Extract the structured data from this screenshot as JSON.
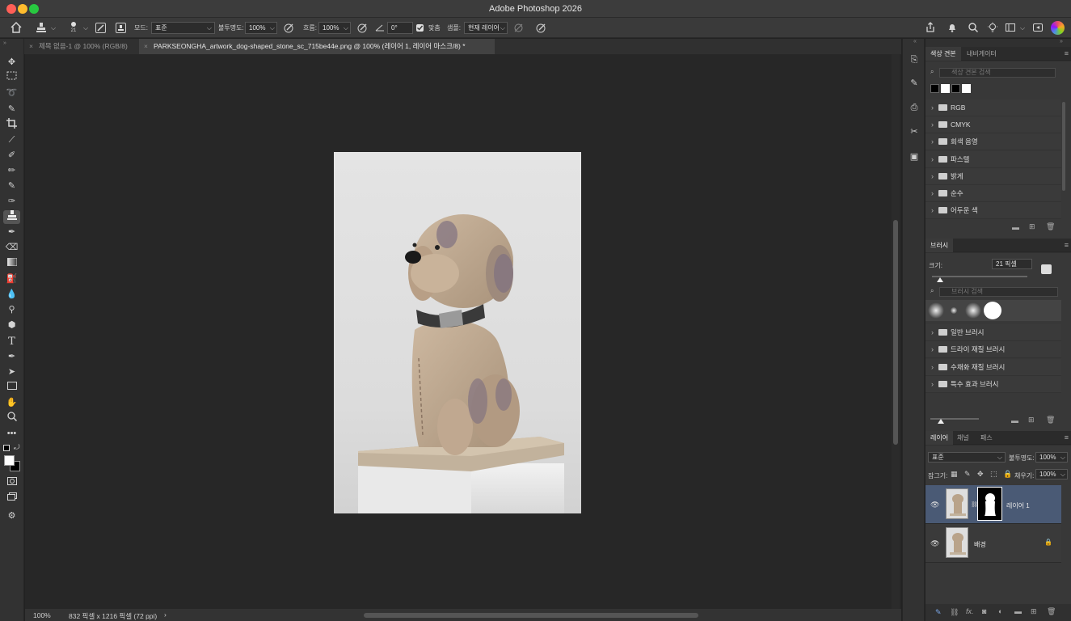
{
  "app": {
    "title": "Adobe Photoshop 2026"
  },
  "options": {
    "brush_size": "21",
    "mode_label": "모드:",
    "mode_value": "표준",
    "opacity_label": "불투명도:",
    "opacity_value": "100%",
    "flow_label": "흐름:",
    "flow_value": "100%",
    "angle_value": "0°",
    "aligned_label": "맞춤",
    "aligned_checked": true,
    "sample_label": "샘플:",
    "sample_value": "현재 레이어"
  },
  "tabs": [
    {
      "label": "제목 없음-1 @ 100% (RGB/8)",
      "active": false
    },
    {
      "label": "PARKSEONGHA_artwork_dog-shaped_stone_sc_715be44e.png @ 100% (레이어 1, 레이어 마스크/8) *",
      "active": true
    }
  ],
  "status": {
    "zoom": "100%",
    "doc_info": "832 픽셀 x 1216 픽셀 (72 ppi)",
    "arrow": "›"
  },
  "swatches_panel": {
    "tabs": [
      "색상 견본",
      "내비게이터"
    ],
    "search_placeholder": "색상 견본 검색",
    "recent_colors": [
      "#000000",
      "#ffffff",
      "#000000",
      "#ffffff"
    ],
    "folders": [
      "RGB",
      "CMYK",
      "회색 음영",
      "파스텔",
      "밝게",
      "순수",
      "어두운 색"
    ]
  },
  "brush_panel": {
    "tab": "브러시",
    "size_label": "크기:",
    "size_value": "21 픽셀",
    "search_placeholder": "브러시 검색",
    "folders": [
      "일반 브러시",
      "드라이 재질 브러시",
      "수채화 재질 브러시",
      "특수 효과 브러시"
    ]
  },
  "layers_panel": {
    "tabs": [
      "레이어",
      "채널",
      "패스"
    ],
    "blend_mode": "표준",
    "opacity_label": "불투명도:",
    "opacity_value": "100%",
    "lock_label": "잠그기:",
    "fill_label": "채우기:",
    "fill_value": "100%",
    "layers": [
      {
        "name": "레이어 1",
        "selected": true,
        "has_mask": true
      },
      {
        "name": "배경",
        "selected": false,
        "locked": true
      }
    ],
    "footer_fx": "fx."
  },
  "colors": {
    "accent": "#4a5a75",
    "canvas_bg": "#272727"
  }
}
